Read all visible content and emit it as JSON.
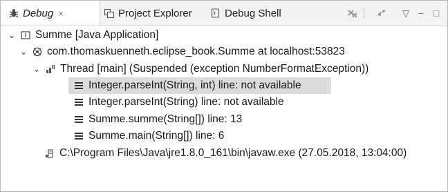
{
  "tabs": [
    {
      "label": "Debug",
      "icon": "debug-bug-icon",
      "close": "×",
      "active": true
    },
    {
      "label": "Project Explorer",
      "icon": "project-explorer-icon"
    },
    {
      "label": "Debug Shell",
      "icon": "debug-shell-icon"
    }
  ],
  "toolbar": {
    "remove_terminated_icon": "remove-terminated-icon",
    "connect_icon": "connect-icon",
    "view_menu_glyph": "▽",
    "minimize_glyph": "−",
    "maximize_glyph": "□"
  },
  "tree": {
    "launch": {
      "label": "Summe [Java Application]",
      "icon": "java-app-icon"
    },
    "target": {
      "label": "com.thomaskuenneth.eclipse_book.Summe at localhost:53823",
      "icon": "debug-target-icon"
    },
    "thread": {
      "label": "Thread [main] (Suspended (exception NumberFormatException))",
      "icon": "thread-suspended-icon"
    },
    "frames": [
      {
        "label": "Integer.parseInt(String, int) line: not available",
        "selected": true
      },
      {
        "label": "Integer.parseInt(String) line: not available"
      },
      {
        "label": "Summe.summe(String[]) line: 13"
      },
      {
        "label": "Summe.main(String[]) line: 6"
      }
    ],
    "process": {
      "label": "C:\\Program Files\\Java\\jre1.8.0_161\\bin\\javaw.exe (27.05.2018, 13:04:00)",
      "icon": "process-icon"
    }
  },
  "colors": {
    "selection": "#dcdcdc",
    "tabbar": "#f3f3f3"
  }
}
